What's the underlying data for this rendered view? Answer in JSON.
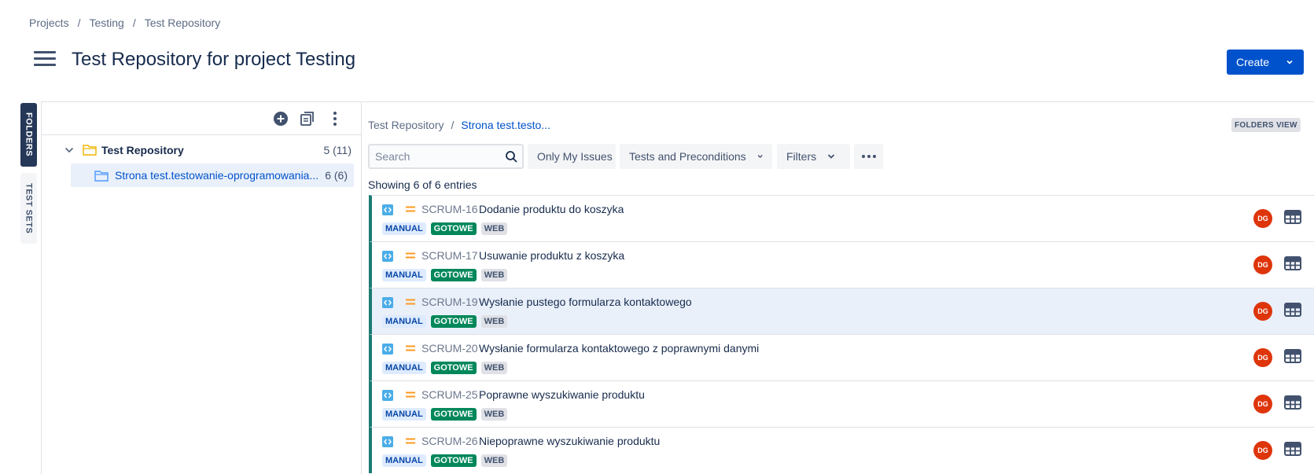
{
  "breadcrumb": {
    "items": [
      "Projects",
      "Testing",
      "Test Repository"
    ],
    "separator": "/"
  },
  "page_title": "Test Repository for project Testing",
  "create_button": {
    "label": "Create"
  },
  "side_tabs": {
    "folders": "FOLDERS",
    "test_sets": "TEST SETS"
  },
  "tree": {
    "root": {
      "label": "Test Repository",
      "count": "5 (11)"
    },
    "child": {
      "label": "Strona test.testowanie-oprogramowania...",
      "count": "6 (6)"
    }
  },
  "content": {
    "breadcrumb": {
      "root": "Test Repository",
      "current": "Strona test.testo...",
      "separator": "/"
    },
    "folders_view": "FOLDERS VIEW",
    "search": {
      "placeholder": "Search",
      "value": ""
    },
    "filters": {
      "only_my_issues": "Only My Issues",
      "tests_and_preconditions": "Tests and Preconditions",
      "filters": "Filters"
    },
    "entries": "Showing 6 of 6 entries"
  },
  "colors": {
    "primary": "#0052cc",
    "row_accent": "#1c7b72",
    "gotowe": "#00875a",
    "avatar": "#de350b",
    "priority": "#ff991f"
  },
  "rows": [
    {
      "key": "SCRUM-16",
      "summary": "Dodanie produktu do koszyka",
      "badges": [
        "MANUAL",
        "GOTOWE",
        "WEB"
      ],
      "avatar": "DG",
      "selected": false
    },
    {
      "key": "SCRUM-17",
      "summary": "Usuwanie produktu z koszyka",
      "badges": [
        "MANUAL",
        "GOTOWE",
        "WEB"
      ],
      "avatar": "DG",
      "selected": false
    },
    {
      "key": "SCRUM-19",
      "summary": "Wysłanie pustego formularza kontaktowego",
      "badges": [
        "MANUAL",
        "GOTOWE",
        "WEB"
      ],
      "avatar": "DG",
      "selected": true
    },
    {
      "key": "SCRUM-20",
      "summary": "Wysłanie formularza kontaktowego z poprawnymi danymi",
      "badges": [
        "MANUAL",
        "GOTOWE",
        "WEB"
      ],
      "avatar": "DG",
      "selected": false
    },
    {
      "key": "SCRUM-25",
      "summary": "Poprawne wyszukiwanie produktu",
      "badges": [
        "MANUAL",
        "GOTOWE",
        "WEB"
      ],
      "avatar": "DG",
      "selected": false
    },
    {
      "key": "SCRUM-26",
      "summary": "Niepoprawne wyszukiwanie produktu",
      "badges": [
        "MANUAL",
        "GOTOWE",
        "WEB"
      ],
      "avatar": "DG",
      "selected": false
    }
  ]
}
